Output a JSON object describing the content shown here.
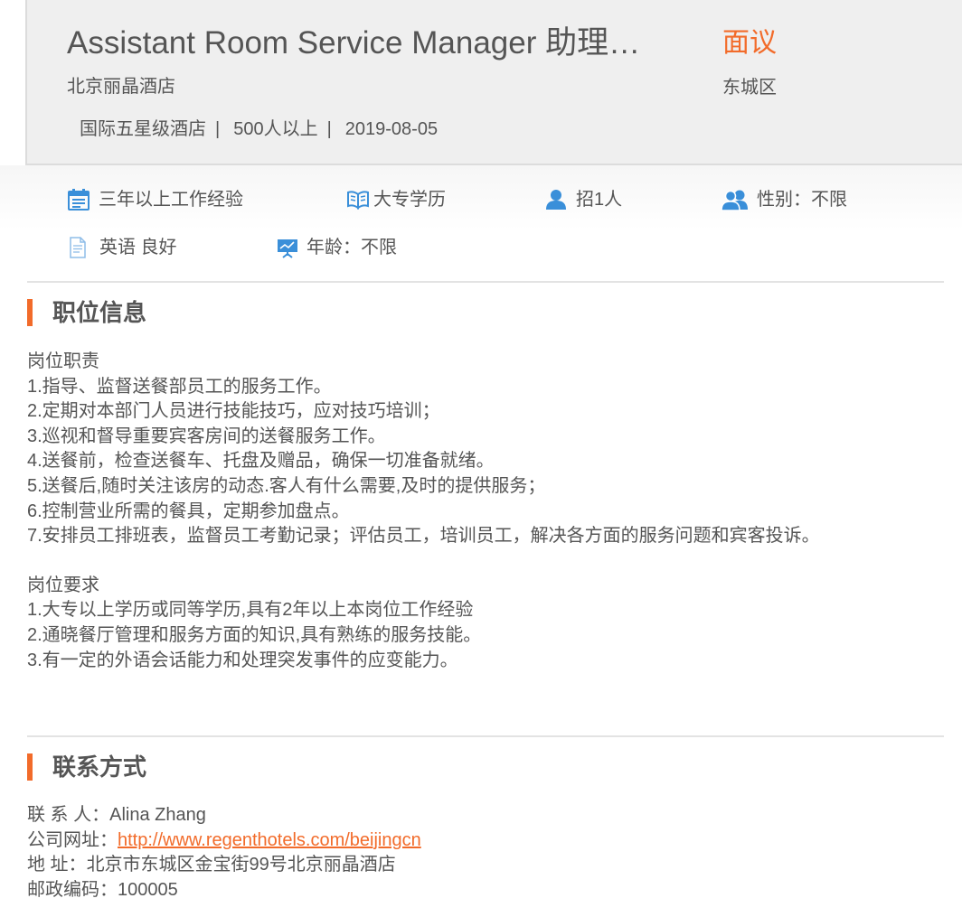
{
  "header": {
    "title": "Assistant Room Service Manager 助理…",
    "salary": "面议",
    "company": "北京丽晶酒店",
    "district": "东城区",
    "meta": [
      "国际五星级酒店",
      "500人以上",
      "2019-08-05"
    ],
    "meta_separator": "|"
  },
  "requirements": [
    {
      "icon": "calendar-icon",
      "label": "三年以上工作经验"
    },
    {
      "icon": "book-icon",
      "label": "大专学历"
    },
    {
      "icon": "person-icon",
      "label": "招1人"
    },
    {
      "icon": "people-icon",
      "label": "性别：不限"
    },
    {
      "icon": "document-icon",
      "label": "英语 良好"
    },
    {
      "icon": "presentation-icon",
      "label": "年龄：不限"
    }
  ],
  "job_section": {
    "heading": "职位信息",
    "duties_title": "岗位职责",
    "duties": [
      "1.指导、监督送餐部员工的服务工作。",
      "2.定期对本部门人员进行技能技巧，应对技巧培训；",
      "3.巡视和督导重要宾客房间的送餐服务工作。",
      "4.送餐前，检查送餐车、托盘及赠品，确保一切准备就绪。",
      "5.送餐后,随时关注该房的动态.客人有什么需要,及时的提供服务；",
      "6.控制营业所需的餐具，定期参加盘点。",
      "7.安排员工排班表，监督员工考勤记录；评估员工，培训员工，解决各方面的服务问题和宾客投诉。"
    ],
    "requirements_title": "岗位要求",
    "requirements": [
      "1.大专以上学历或同等学历,具有2年以上本岗位工作经验",
      "2.通晓餐厅管理和服务方面的知识,具有熟练的服务技能。",
      "3.有一定的外语会话能力和处理突发事件的应变能力。"
    ]
  },
  "contact_section": {
    "heading": "联系方式",
    "contact_label": "联 系 人：",
    "contact_name": "Alina Zhang",
    "website_label": "公司网址：",
    "website_url": "http://www.regenthotels.com/beijingcn",
    "address_label": "地 址：",
    "address": "北京市东城区金宝街99号北京丽晶酒店",
    "postcode_label": "邮政编码：",
    "postcode": "100005"
  },
  "colors": {
    "accent": "#f26b2a",
    "icon_blue": "#3a8fd9",
    "text": "#555555",
    "header_bg": "#efefef"
  }
}
